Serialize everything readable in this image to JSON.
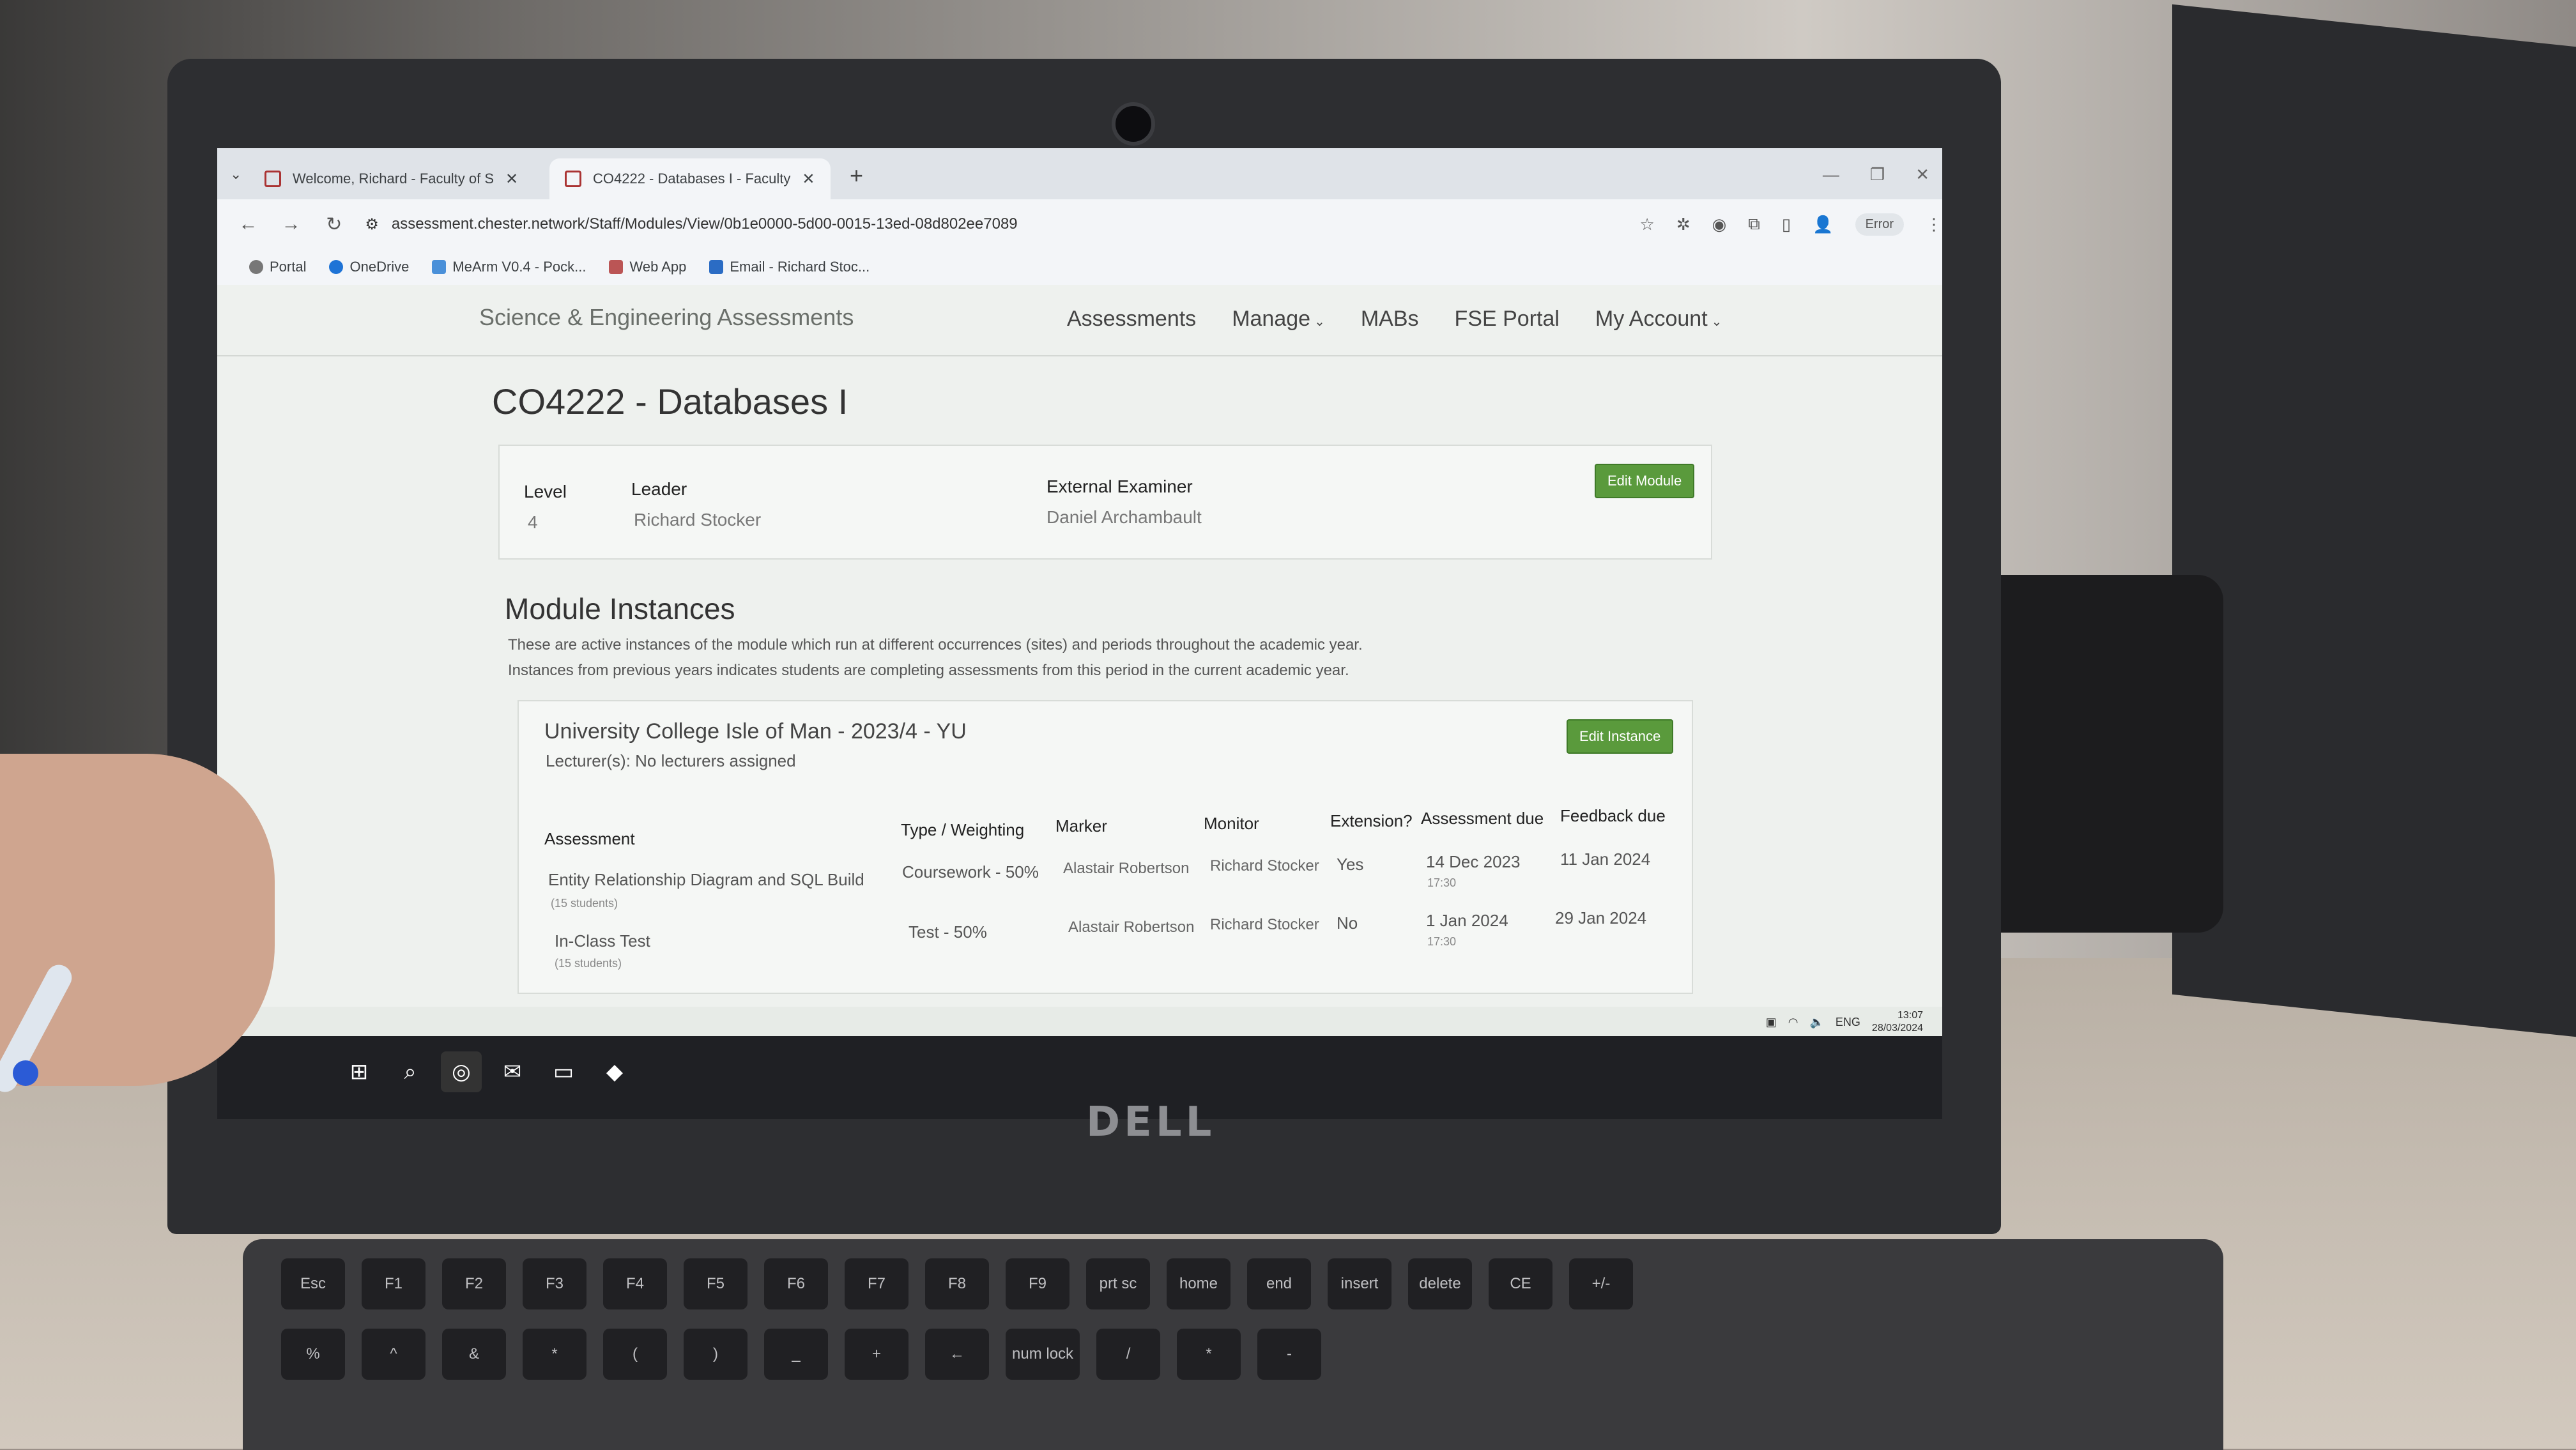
{
  "browser": {
    "tabs": [
      {
        "title": "Welcome, Richard - Faculty of S"
      },
      {
        "title": "CO4222 - Databases I - Faculty"
      }
    ],
    "url": "assessment.chester.network/Staff/Modules/View/0b1e0000-5d00-0015-13ed-08d802ee7089",
    "error_label": "Error",
    "bookmarks": [
      {
        "label": "Portal"
      },
      {
        "label": "OneDrive"
      },
      {
        "label": "MeArm V0.4 - Pock..."
      },
      {
        "label": "Web App"
      },
      {
        "label": "Email - Richard Stoc..."
      }
    ]
  },
  "site": {
    "brand": "Science & Engineering Assessments",
    "nav": [
      "Assessments",
      "Manage",
      "MABs",
      "FSE Portal",
      "My Account"
    ]
  },
  "module": {
    "title": "CO4222 - Databases I",
    "level_label": "Level",
    "level": "4",
    "leader_label": "Leader",
    "leader": "Richard Stocker",
    "examiner_label": "External Examiner",
    "examiner": "Daniel Archambault",
    "edit_button": "Edit Module"
  },
  "instances": {
    "heading": "Module Instances",
    "desc1": "These are active instances of the module which run at different occurrences (sites) and periods throughout the academic year.",
    "desc2": "Instances from previous years indicates students are completing assessments from this period in the current academic year.",
    "instance": {
      "title": "University College Isle of Man - 2023/4 - YU",
      "lecturers": "Lecturer(s): No lecturers assigned",
      "edit_button": "Edit Instance",
      "columns": [
        "Assessment",
        "Type / Weighting",
        "Marker",
        "Monitor",
        "Extension?",
        "Assessment due",
        "Feedback due"
      ],
      "rows": [
        {
          "name": "Entity Relationship Diagram and SQL Build",
          "students": "(15 students)",
          "type": "Coursework - 50%",
          "marker": "Alastair Robertson",
          "monitor": "Richard Stocker",
          "extension": "Yes",
          "due": "14 Dec 2023",
          "due_time": "17:30",
          "feedback": "11 Jan 2024"
        },
        {
          "name": "In-Class Test",
          "students": "(15 students)",
          "type": "Test - 50%",
          "marker": "Alastair Robertson",
          "monitor": "Richard Stocker",
          "extension": "No",
          "due": "1 Jan 2024",
          "due_time": "17:30",
          "feedback": "29 Jan 2024"
        }
      ]
    }
  },
  "system_tray": {
    "lang": "ENG",
    "time": "13:07",
    "date": "28/03/2024"
  },
  "laptop": {
    "brand": "DELL",
    "keys_row1": [
      "Esc",
      "F1",
      "F2",
      "F3",
      "F4",
      "F5",
      "F6",
      "F7",
      "F8",
      "F9",
      "prt sc",
      "home",
      "end",
      "insert",
      "delete",
      "CE",
      "+/-"
    ],
    "keys_row2": [
      "%",
      "^",
      "&",
      "*",
      "(",
      ")",
      "_",
      "+",
      "←",
      "num lock",
      "/",
      "*",
      "-"
    ]
  }
}
